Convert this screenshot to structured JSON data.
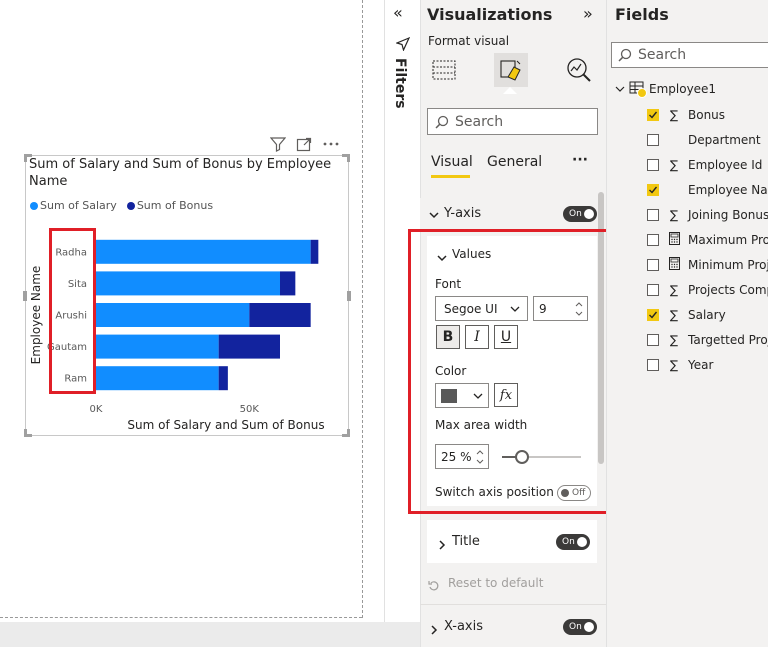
{
  "chart": {
    "title": "Sum of Salary and Sum of Bonus by Employee Name",
    "legend": [
      "Sum of Salary",
      "Sum of Bonus"
    ],
    "colors": {
      "salary": "#118dff",
      "bonus": "#12239e"
    },
    "xlabel": "Sum of Salary and Sum of Bonus",
    "ylabel": "Employee Name",
    "x_ticks": [
      "0K",
      "50K"
    ]
  },
  "chart_data": {
    "type": "bar",
    "orientation": "horizontal",
    "stacked": true,
    "title": "Sum of Salary and Sum of Bonus by Employee Name",
    "xlabel": "Sum of Salary and Sum of Bonus",
    "ylabel": "Employee Name",
    "categories": [
      "Radha",
      "Sita",
      "Arushi",
      "Gautam",
      "Ram"
    ],
    "series": [
      {
        "name": "Sum of Salary",
        "values": [
          70000,
          60000,
          50000,
          40000,
          40000
        ]
      },
      {
        "name": "Sum of Bonus",
        "values": [
          2500,
          5000,
          20000,
          20000,
          3000
        ]
      }
    ],
    "xlim": [
      0,
      75000
    ],
    "x_ticks": [
      "0K",
      "50K"
    ],
    "legend_position": "top-left",
    "grid": false
  },
  "visualizations": {
    "title": "Visualizations",
    "format_visual": "Format visual",
    "search_placeholder": "Search",
    "tabs": [
      "Visual",
      "General"
    ],
    "more": "···",
    "y_axis": {
      "label": "Y-axis",
      "toggle": "On"
    },
    "values": {
      "label": "Values",
      "font_label": "Font",
      "font_family": "Segoe UI",
      "font_size": "9",
      "bold": "B",
      "italic": "I",
      "underline": "U",
      "color_label": "Color",
      "color_value": "#595959",
      "fx": "fx",
      "max_area_label": "Max area width",
      "max_area_value": "25",
      "max_area_unit": "%",
      "max_area_slider": 0.25,
      "switch_label": "Switch axis position",
      "switch_toggle": "Off"
    },
    "title_section": {
      "label": "Title",
      "toggle": "On"
    },
    "reset": "Reset to default",
    "x_axis": {
      "label": "X-axis",
      "toggle": "On"
    }
  },
  "filters": {
    "label": "Filters"
  },
  "fields": {
    "title": "Fields",
    "search_placeholder": "Search",
    "table": "Employee1",
    "items": [
      {
        "name": "Bonus",
        "sigma": true,
        "checked": true
      },
      {
        "name": "Department",
        "sigma": false,
        "checked": false
      },
      {
        "name": "Employee Id",
        "sigma": true,
        "checked": false
      },
      {
        "name": "Employee Nam",
        "sigma": false,
        "checked": true
      },
      {
        "name": "Joining Bonus",
        "sigma": true,
        "checked": false
      },
      {
        "name": "Maximum Proje",
        "sigma": false,
        "calc": true,
        "checked": false
      },
      {
        "name": "Minimum Proje",
        "sigma": false,
        "calc": true,
        "checked": false
      },
      {
        "name": "Projects Compl",
        "sigma": true,
        "checked": false
      },
      {
        "name": "Salary",
        "sigma": true,
        "checked": true
      },
      {
        "name": "Targetted Proje",
        "sigma": true,
        "checked": false
      },
      {
        "name": "Year",
        "sigma": true,
        "checked": false
      }
    ]
  }
}
